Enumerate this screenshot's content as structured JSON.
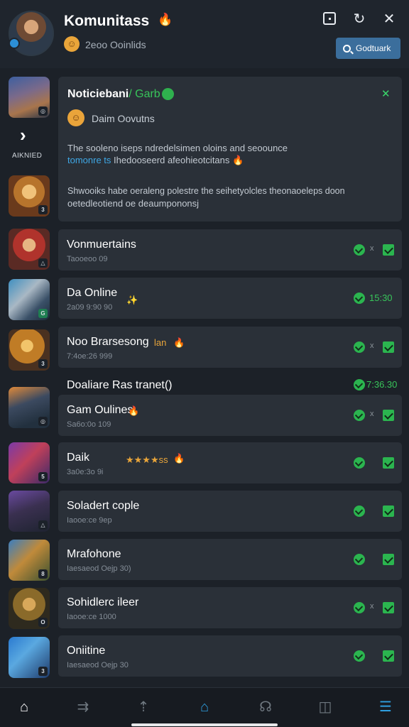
{
  "header": {
    "title": "Komunitass",
    "title_icon": "flame-icon",
    "subtitle": "2eoo Ooinlids",
    "search_label": "Godtuark"
  },
  "sidebar": {
    "arrow_label": "AIKNIED"
  },
  "notice": {
    "title": "Noticiebani",
    "title_tag": "/ Garb",
    "user": "Daim Oovutns",
    "line1": "The sooleno iseps ndredelsimen oloins and seoounce",
    "line2_blue": "tomonre ts",
    "line2_rest": "Ihedooseerd afeohieotcitans",
    "line3": "Shwooiks habe oeraleng polestre the seihetyolcles theonaoeleps doon",
    "line4": "oetedleotiend oe deaumpononsj"
  },
  "rows": [
    {
      "title": "Vonmuertains",
      "sub": "Taooeoo 09",
      "extra": "",
      "status": "x"
    },
    {
      "title": "Da Online",
      "sub": "2a09 9:90 90",
      "extra": "",
      "status": "15:30"
    },
    {
      "title": "Noo Brarsesong",
      "sub": "7:4oe:26 999",
      "extra": "lan",
      "status": "x"
    },
    {
      "title": "Doaliare Ras tranet()",
      "sub": "",
      "extra": "",
      "status": "7:36.30"
    },
    {
      "title": "Gam Oulines",
      "sub": "Sa6o:0o 109",
      "extra": "",
      "status": "x"
    },
    {
      "title": "Daik",
      "sub": "3a0e:3o 9i",
      "extra": "★★★★ss",
      "status": ""
    },
    {
      "title": "Soladert cople",
      "sub": "Iaooe:ce 9ep",
      "extra": "",
      "status": ""
    },
    {
      "title": "Mrafohone",
      "sub": "Iaesaeod Oejp 30)",
      "extra": "",
      "status": ""
    },
    {
      "title": "Sohidlerc ileer",
      "sub": "Iaooe:ce 1000",
      "extra": "",
      "status": "x"
    },
    {
      "title": "Oniitine",
      "sub": "Iaesaeod Oejp 30",
      "extra": "",
      "status": ""
    }
  ],
  "colors": {
    "background": "#1c2128",
    "card": "#2a3038",
    "accent_green": "#2bb54f",
    "accent_blue": "#3b6e9c",
    "flame": "#f0a23a"
  },
  "nav": {
    "items": [
      "home-icon",
      "swipe-icon",
      "upload-icon",
      "community-icon",
      "profile-icon",
      "save-icon",
      "menu-icon"
    ]
  }
}
